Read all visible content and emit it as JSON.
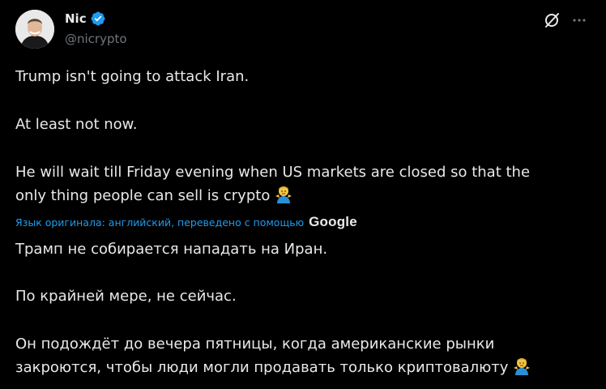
{
  "author": {
    "display_name": "Nic",
    "handle": "@nicrypto",
    "verified": true
  },
  "header_icons": {
    "grok": "grok-icon",
    "more": "more-icon"
  },
  "tweet": {
    "original": {
      "p1": "Trump isn't going to attack Iran.",
      "p2": "At least not now.",
      "p3": "He will wait till Friday evening when US markets are closed so that the\nonly thing people can sell is crypto"
    },
    "translation_note": "Язык оригинала: английский, переведено с помощью",
    "translation_provider": "Google",
    "translated": {
      "p1": "Трамп не собирается нападать на Иран.",
      "p2": "По крайней мере, не сейчас.",
      "p3": "Он подождёт до вечера пятницы, когда американские рынки\nзакроются, чтобы люди могли продавать только криптовалюту"
    },
    "emoji": "person-shrugging-emoji"
  },
  "colors": {
    "background": "#000000",
    "text": "#e7e9ea",
    "secondary": "#71767b",
    "accent": "#1d9bf0"
  }
}
